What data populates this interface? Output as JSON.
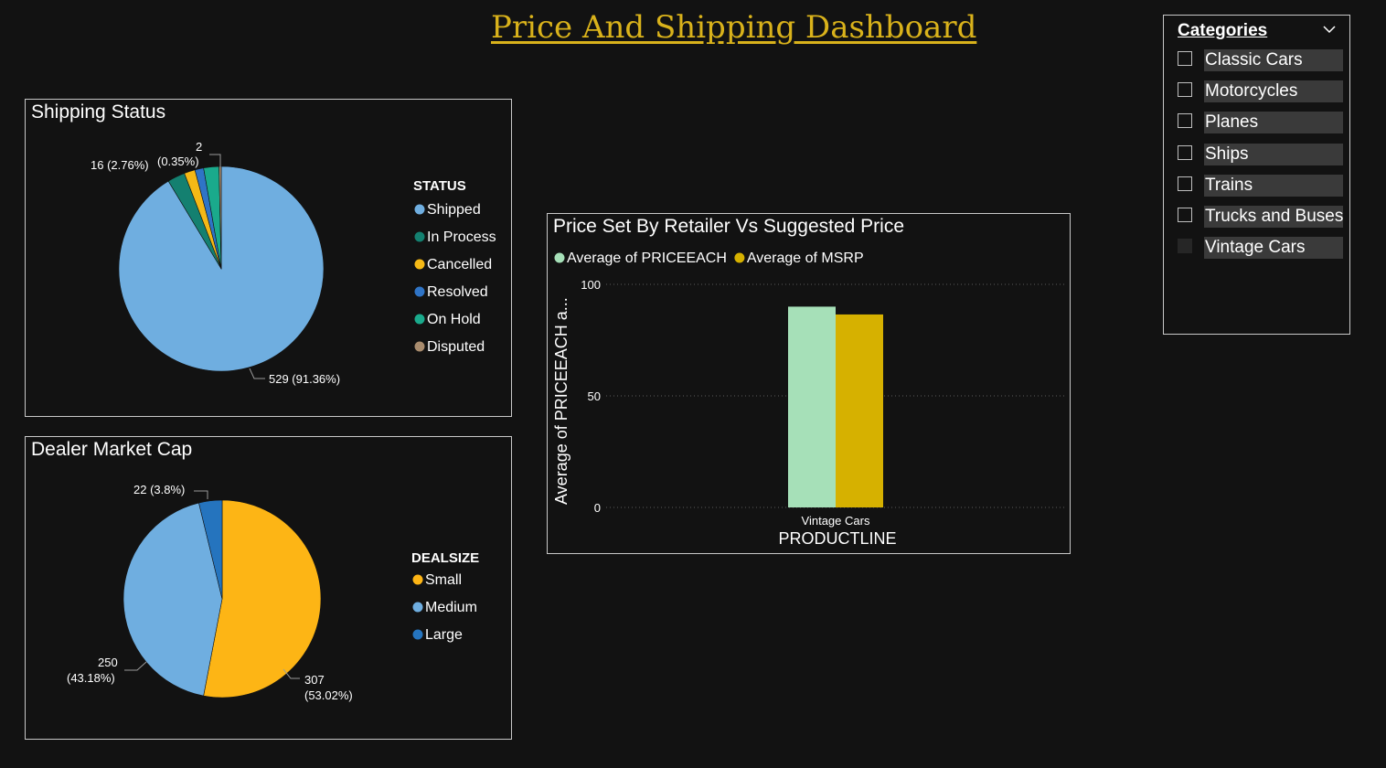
{
  "dashboard": {
    "title": "Price And Shipping Dashboard"
  },
  "shipping": {
    "title": "Shipping Status",
    "legend_title": "STATUS",
    "labels": {
      "shipped": "529 (91.36%)",
      "in_process": "16 (2.76%)",
      "cancelled": "(0.35%)",
      "disputed": "2"
    }
  },
  "dealer": {
    "title": "Dealer Market Cap",
    "legend_title": "DEALSIZE",
    "labels": {
      "large": "22 (3.8%)",
      "medium_line1": "250",
      "medium_line2": "(43.18%)",
      "small_line1": "307",
      "small_line2": "(53.02%)"
    }
  },
  "price_chart": {
    "title": "Price Set By Retailer Vs Suggested Price",
    "ylabel": "Average of PRICEEACH a...",
    "xlabel": "PRODUCTLINE"
  },
  "slicer": {
    "title": "Categories",
    "items": [
      {
        "label": "Classic Cars",
        "checked": false
      },
      {
        "label": "Motorcycles",
        "checked": false
      },
      {
        "label": "Planes",
        "checked": false
      },
      {
        "label": "Ships",
        "checked": false
      },
      {
        "label": "Trains",
        "checked": false
      },
      {
        "label": "Trucks and Buses",
        "checked": false
      },
      {
        "label": "Vintage Cars",
        "checked": true
      }
    ]
  },
  "chart_data": [
    {
      "type": "pie",
      "title": "Shipping Status",
      "legend_title": "STATUS",
      "legend_position": "right",
      "series": [
        {
          "name": "Shipped",
          "value": 529,
          "percent": 91.36,
          "color": "#6FAEE0"
        },
        {
          "name": "In Process",
          "value": 16,
          "percent": 2.76,
          "color": "#148070"
        },
        {
          "name": "Cancelled",
          "value": 10,
          "color": "#F5B916"
        },
        {
          "name": "Resolved",
          "value": 8,
          "color": "#2F74C6"
        },
        {
          "name": "On Hold",
          "value": 14,
          "color": "#1AAA8C"
        },
        {
          "name": "Disputed",
          "value": 2,
          "percent": 0.35,
          "color": "#A98C6E"
        }
      ]
    },
    {
      "type": "pie",
      "title": "Dealer Market Cap",
      "legend_title": "DEALSIZE",
      "legend_position": "right",
      "series": [
        {
          "name": "Small",
          "value": 307,
          "percent": 53.02,
          "color": "#FDB515"
        },
        {
          "name": "Medium",
          "value": 250,
          "percent": 43.18,
          "color": "#6FAEE0"
        },
        {
          "name": "Large",
          "value": 22,
          "percent": 3.8,
          "color": "#2574BE"
        }
      ]
    },
    {
      "type": "bar",
      "title": "Price Set By Retailer Vs Suggested Price",
      "categories": [
        "Vintage Cars"
      ],
      "series": [
        {
          "name": "Average of PRICEEACH",
          "values": [
            90
          ],
          "color": "#A6E0B8"
        },
        {
          "name": "Average of MSRP",
          "values": [
            86.5
          ],
          "color": "#D6B100"
        }
      ],
      "xlabel": "PRODUCTLINE",
      "ylabel": "Average of PRICEEACH a...",
      "yticks": [
        0,
        50,
        100
      ],
      "ylim": [
        0,
        100
      ],
      "grid": true,
      "legend_position": "top-left"
    }
  ]
}
